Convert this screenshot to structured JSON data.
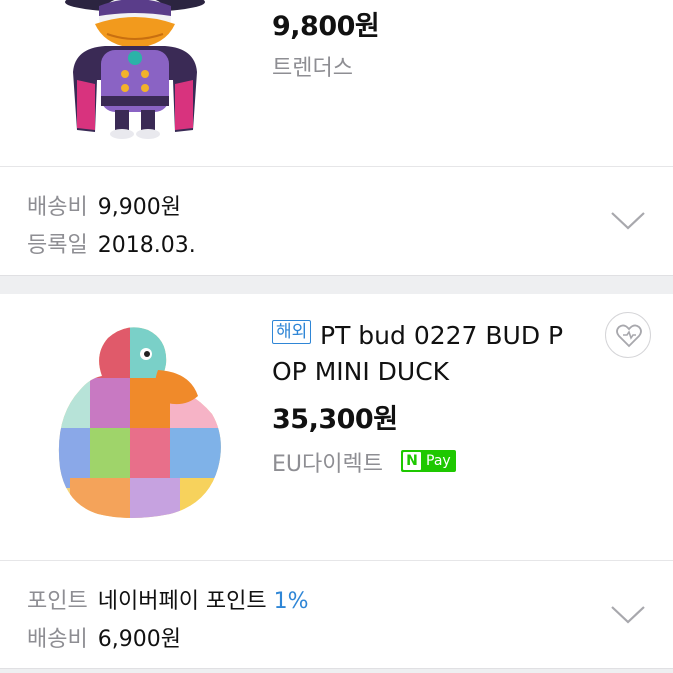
{
  "product1": {
    "image_alt": "duck villain figure",
    "price": "9,800원",
    "seller": "트렌더스",
    "shipping_label": "배송비",
    "shipping_value": "9,900원",
    "registered_label": "등록일",
    "registered_value": "2018.03."
  },
  "product2": {
    "overseas_badge": "해외",
    "title": "PT bud 0227 BUD POP MINI DUCK",
    "price": "35,300원",
    "seller": "EU다이렉트",
    "npay_n": "N",
    "npay_label": "Pay",
    "points_label": "포인트",
    "points_value": "네이버페이 포인트",
    "points_percent": "1%",
    "shipping_label": "배송비",
    "shipping_value": "6,900원"
  },
  "colors": {
    "accent": "#2f86d6",
    "npay_green": "#1ec800",
    "muted": "#8e8e93"
  },
  "icons": [
    "chevron-down-icon",
    "heart-icon"
  ]
}
